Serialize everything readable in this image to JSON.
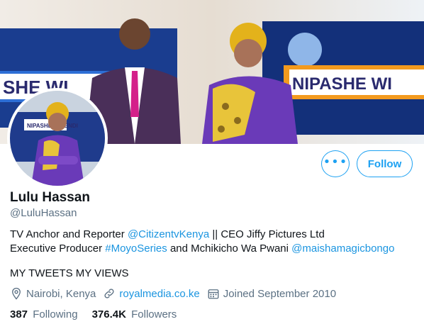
{
  "profile": {
    "display_name": "Lulu Hassan",
    "handle": "@LuluHassan",
    "banner_text_left": "SHE WI",
    "banner_text_right": "NIPASHE WI",
    "avatar_banner_text": "NIPASHE WIKENDI"
  },
  "actions": {
    "more_label": "•••",
    "follow_label": "Follow"
  },
  "bio": {
    "line1_prefix": "TV Anchor and Reporter ",
    "line1_mention": "@CitizentvKenya",
    "line1_suffix": " || CEO Jiffy Pictures Ltd",
    "line2_prefix": "Executive Producer ",
    "line2_hashtag": "#MoyoSeries",
    "line2_middle": " and Mchikicho Wa Pwani ",
    "line2_mention": "@maishamagicbongo"
  },
  "tagline": "MY TWEETS MY VIEWS",
  "meta": {
    "location": "Nairobi, Kenya",
    "website": "royalmedia.co.ke",
    "joined": "Joined September 2010"
  },
  "stats": {
    "following_count": "387",
    "following_label": "Following",
    "followers_count": "376.4K",
    "followers_label": "Followers"
  },
  "colors": {
    "accent": "#1da1f2",
    "link": "#1b95e0",
    "secondary_text": "#5b7083"
  }
}
